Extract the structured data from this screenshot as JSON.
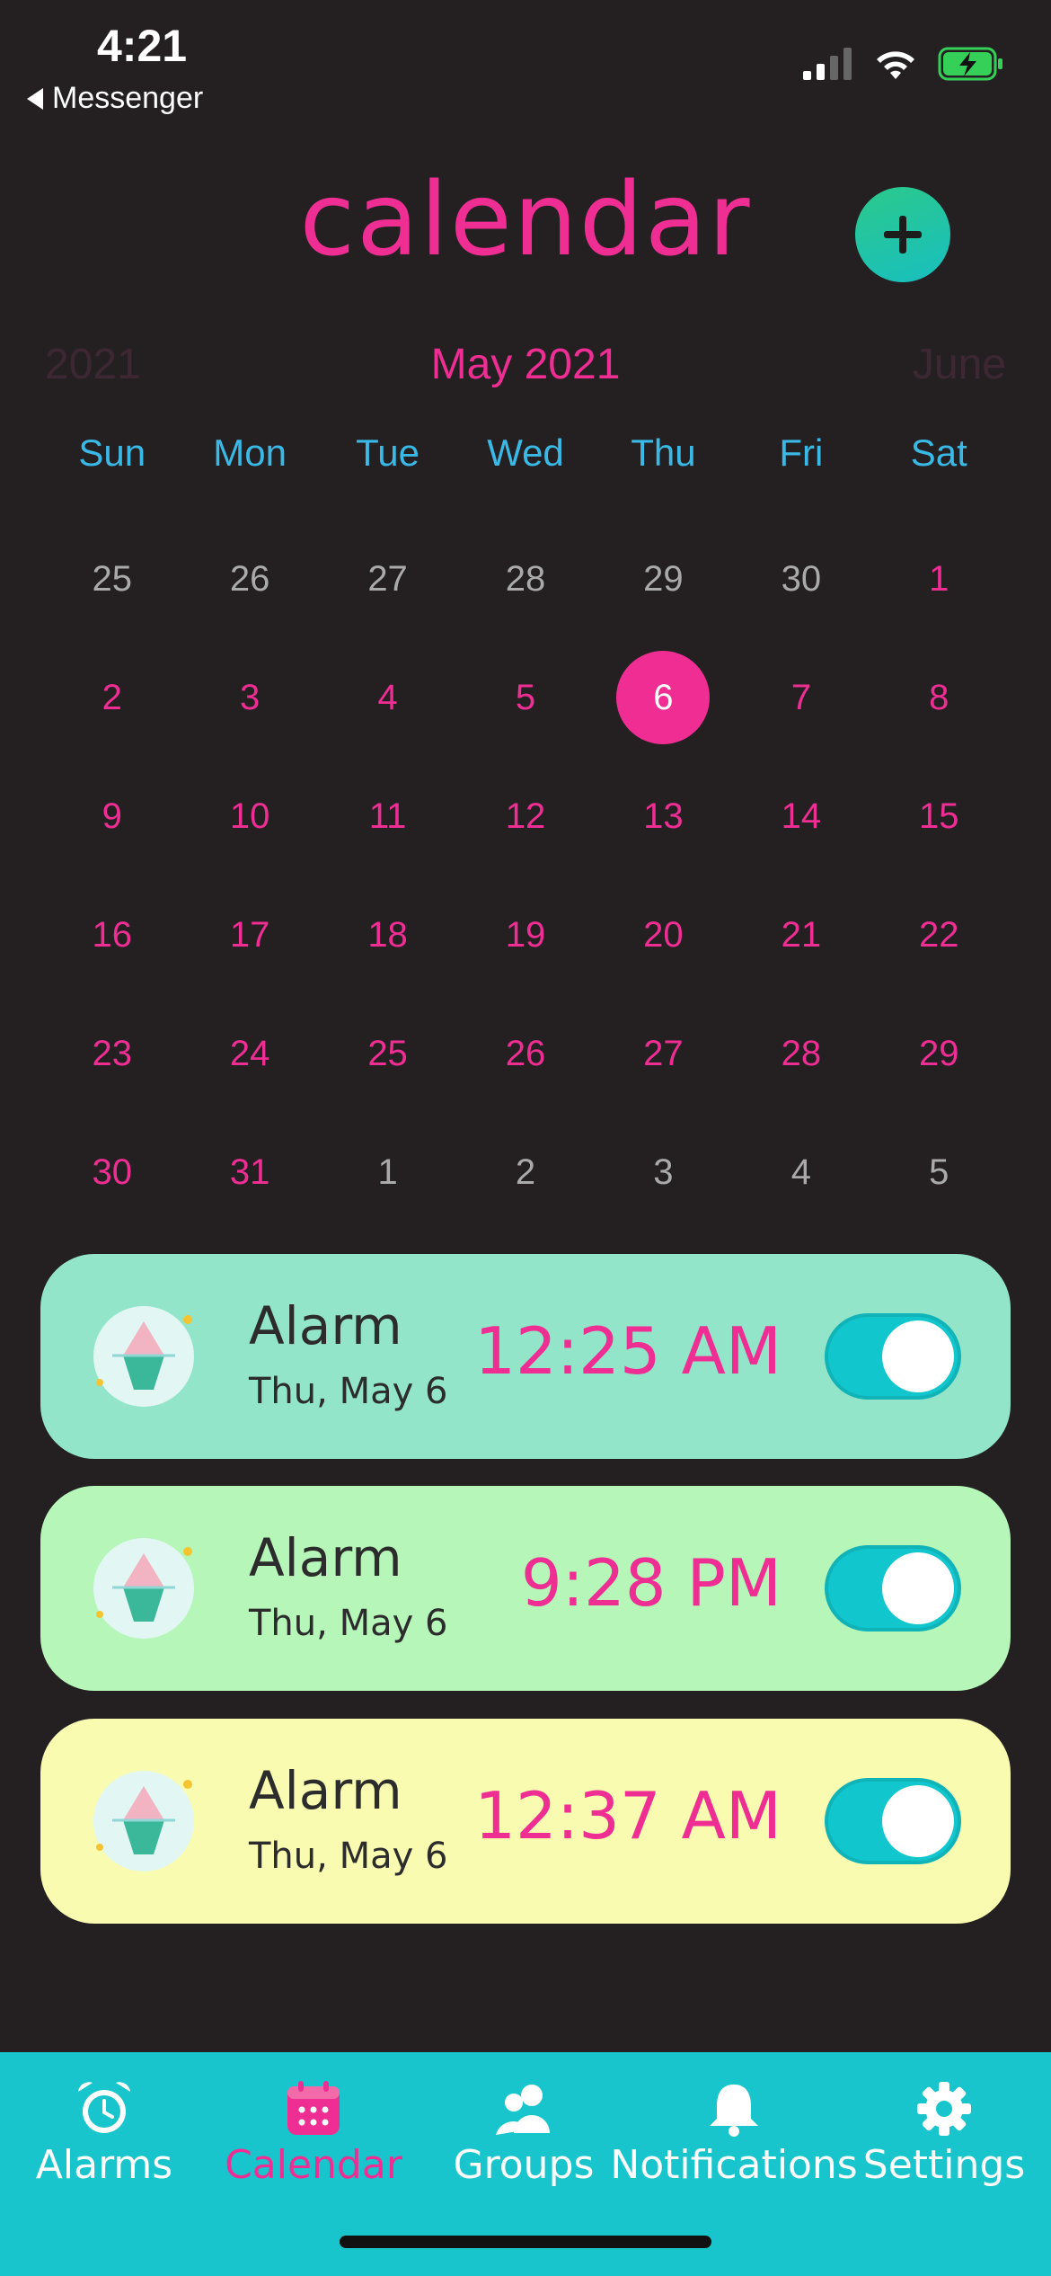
{
  "status_bar": {
    "time": "4:21",
    "back_label": "Messenger"
  },
  "header": {
    "title": "calendar",
    "add_icon": "plus-icon"
  },
  "month_nav": {
    "prev": "2021",
    "current": "May 2021",
    "next": "June"
  },
  "weekdays": [
    "Sun",
    "Mon",
    "Tue",
    "Wed",
    "Thu",
    "Fri",
    "Sat"
  ],
  "days": [
    {
      "label": "25",
      "state": "other"
    },
    {
      "label": "26",
      "state": "other"
    },
    {
      "label": "27",
      "state": "other"
    },
    {
      "label": "28",
      "state": "other"
    },
    {
      "label": "29",
      "state": "other"
    },
    {
      "label": "30",
      "state": "other"
    },
    {
      "label": "1",
      "state": "cur"
    },
    {
      "label": "2",
      "state": "cur"
    },
    {
      "label": "3",
      "state": "cur"
    },
    {
      "label": "4",
      "state": "cur"
    },
    {
      "label": "5",
      "state": "cur"
    },
    {
      "label": "6",
      "state": "selected"
    },
    {
      "label": "7",
      "state": "cur"
    },
    {
      "label": "8",
      "state": "cur"
    },
    {
      "label": "9",
      "state": "cur"
    },
    {
      "label": "10",
      "state": "cur"
    },
    {
      "label": "11",
      "state": "cur"
    },
    {
      "label": "12",
      "state": "cur"
    },
    {
      "label": "13",
      "state": "cur"
    },
    {
      "label": "14",
      "state": "cur"
    },
    {
      "label": "15",
      "state": "cur"
    },
    {
      "label": "16",
      "state": "cur"
    },
    {
      "label": "17",
      "state": "cur"
    },
    {
      "label": "18",
      "state": "cur"
    },
    {
      "label": "19",
      "state": "cur"
    },
    {
      "label": "20",
      "state": "cur"
    },
    {
      "label": "21",
      "state": "cur"
    },
    {
      "label": "22",
      "state": "cur"
    },
    {
      "label": "23",
      "state": "cur"
    },
    {
      "label": "24",
      "state": "cur"
    },
    {
      "label": "25",
      "state": "cur"
    },
    {
      "label": "26",
      "state": "cur"
    },
    {
      "label": "27",
      "state": "cur"
    },
    {
      "label": "28",
      "state": "cur"
    },
    {
      "label": "29",
      "state": "cur"
    },
    {
      "label": "30",
      "state": "cur"
    },
    {
      "label": "31",
      "state": "cur"
    },
    {
      "label": "1",
      "state": "other"
    },
    {
      "label": "2",
      "state": "other"
    },
    {
      "label": "3",
      "state": "other"
    },
    {
      "label": "4",
      "state": "other"
    },
    {
      "label": "5",
      "state": "other"
    }
  ],
  "alarms": [
    {
      "title": "Alarm",
      "date": "Thu, May 6",
      "time": "12:25 AM",
      "enabled": true,
      "bg": "#93e5c9"
    },
    {
      "title": "Alarm",
      "date": "Thu, May 6",
      "time": "9:28 PM",
      "enabled": true,
      "bg": "#b6f7b9"
    },
    {
      "title": "Alarm",
      "date": "Thu, May 6",
      "time": "12:37 AM",
      "enabled": true,
      "bg": "#f8fbb0"
    }
  ],
  "tabs": [
    {
      "label": "Alarms",
      "icon": "alarm-clock-icon",
      "active": false
    },
    {
      "label": "Calendar",
      "icon": "calendar-icon",
      "active": true
    },
    {
      "label": "Groups",
      "icon": "groups-icon",
      "active": false
    },
    {
      "label": "Notifications",
      "icon": "bell-icon",
      "active": false
    },
    {
      "label": "Settings",
      "icon": "gear-icon",
      "active": false
    }
  ],
  "colors": {
    "accent": "#ef2e93",
    "weekday": "#3bb9e6",
    "tabbar": "#18c5cc",
    "background": "#242022"
  }
}
